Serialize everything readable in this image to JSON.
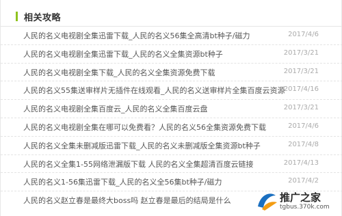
{
  "section": {
    "title": "相关攻略"
  },
  "articles": [
    {
      "title": "人民的名义电视剧全集迅雷下载_人民的名义56集全高清bt种子/磁力",
      "date": "2017/4/6"
    },
    {
      "title": "人民的名义电视剧全集迅雷下载_人民的名义全集资源bt种子",
      "date": "2017/3/21"
    },
    {
      "title": "人民的名义电视剧全集下载_人民的名义全集资源免费下载",
      "date": "2017/3/21"
    },
    {
      "title": "人民的名义55集送审样片无插件在线观看_人民的名义送审样片全集百度云资源",
      "date": "2017/4/16"
    },
    {
      "title": "人民的名义电视剧全集百度云_人民的名义全集百度云盘",
      "date": "2017/3/21"
    },
    {
      "title": "人民的名义电视剧全集在哪可以免费看？人民的名义56全集资源免费下载",
      "date": "2017/4/6"
    },
    {
      "title": "人民的名义全集未删减版迅雷下载_人民的名义未删减版全集资源bt种子",
      "date": "2017/4/8"
    },
    {
      "title": "人民的名义全集1-55网络泄漏版下载 人民的名义全集超清百度云链接",
      "date": "2017/4/13"
    },
    {
      "title": "人民的名义1-56集迅雷下载_人民的名义全56集bt种子/磁力",
      "date": "2017/4/2"
    },
    {
      "title": "人民的名义赵立春是最终大boss吗 赵立春是最后的结局是什么",
      "date": ""
    }
  ],
  "watermark": {
    "text": "推广之家",
    "url": "tgbus.370k.com",
    "icon": "promo-logo-icon",
    "colors": {
      "logo_blue": "#1a6fc0",
      "logo_orange": "#f39c12"
    }
  },
  "colors": {
    "accent": "#8fc31f",
    "title_text": "#333333",
    "item_text": "#555555",
    "date_text": "#aaaaaa"
  }
}
